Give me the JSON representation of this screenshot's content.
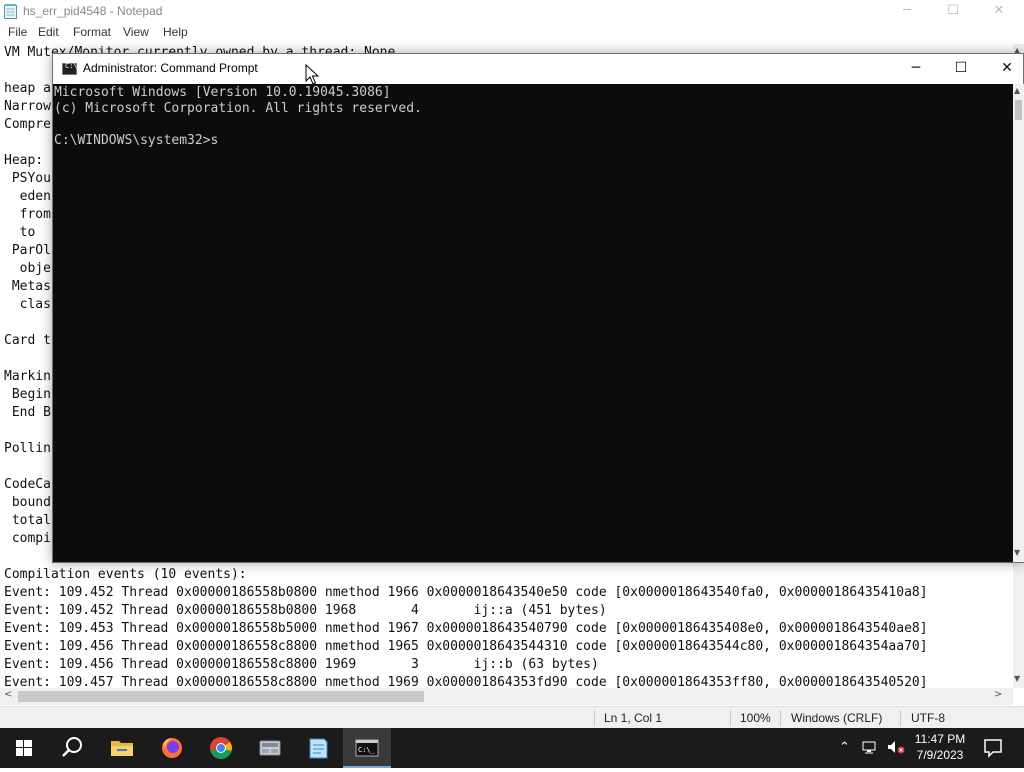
{
  "notepad": {
    "title": "hs_err_pid4548 - Notepad",
    "window_controls": {
      "minimize": "─",
      "maximize": "☐",
      "close": "✕"
    },
    "menu": [
      "File",
      "Edit",
      "Format",
      "View",
      "Help"
    ],
    "lines": [
      "VM Mutex/Monitor currently owned by a thread: None",
      "",
      "heap a",
      "Narrow",
      "Compre",
      "",
      "Heap:",
      " PSYou",
      "  eden",
      "  from",
      "  to",
      " ParOl",
      "  obje",
      " Metas",
      "  clas",
      "",
      "Card t",
      "",
      "Markin",
      " Begin",
      " End B",
      "",
      "Pollin",
      "",
      "CodeCa",
      " bound",
      " total",
      " compi",
      "",
      "Compilation events (10 events):",
      "Event: 109.452 Thread 0x00000186558b0800 nmethod 1966 0x0000018643540e50 code [0x0000018643540fa0, 0x00000186435410a8]",
      "Event: 109.452 Thread 0x00000186558b0800 1968       4       ij::a (451 bytes)",
      "Event: 109.453 Thread 0x00000186558b5000 nmethod 1967 0x0000018643540790 code [0x00000186435408e0, 0x0000018643540ae8]",
      "Event: 109.456 Thread 0x00000186558c8800 nmethod 1965 0x0000018643544310 code [0x0000018643544c80, 0x000001864354aa70]",
      "Event: 109.456 Thread 0x00000186558c8800 1969       3       ij::b (63 bytes)",
      "Event: 109.457 Thread 0x00000186558c8800 nmethod 1969 0x000001864353fd90 code [0x000001864353ff80, 0x0000018643540520]"
    ],
    "status": {
      "position": "Ln 1, Col 1",
      "zoom": "100%",
      "line_ending": "Windows (CRLF)",
      "encoding": "UTF-8"
    }
  },
  "cmd": {
    "title": "Administrator: Command Prompt",
    "window_controls": {
      "minimize": "─",
      "maximize": "☐",
      "close": "✕"
    },
    "lines": [
      "Microsoft Windows [Version 10.0.19045.3086]",
      "(c) Microsoft Corporation. All rights reserved.",
      "",
      "C:\\WINDOWS\\system32>s"
    ]
  },
  "taskbar": {
    "items": [
      {
        "name": "start-button",
        "icon": "windows-logo-icon"
      },
      {
        "name": "search-button",
        "icon": "search-icon"
      },
      {
        "name": "file-explorer",
        "icon": "folder-icon"
      },
      {
        "name": "firefox",
        "icon": "firefox-icon"
      },
      {
        "name": "chrome",
        "icon": "chrome-icon"
      },
      {
        "name": "app-generic",
        "icon": "app-icon"
      },
      {
        "name": "notepad",
        "icon": "notepad-icon"
      },
      {
        "name": "command-prompt",
        "icon": "cmd-icon",
        "active": true
      }
    ],
    "time": "11:47 PM",
    "date": "7/9/2023"
  }
}
